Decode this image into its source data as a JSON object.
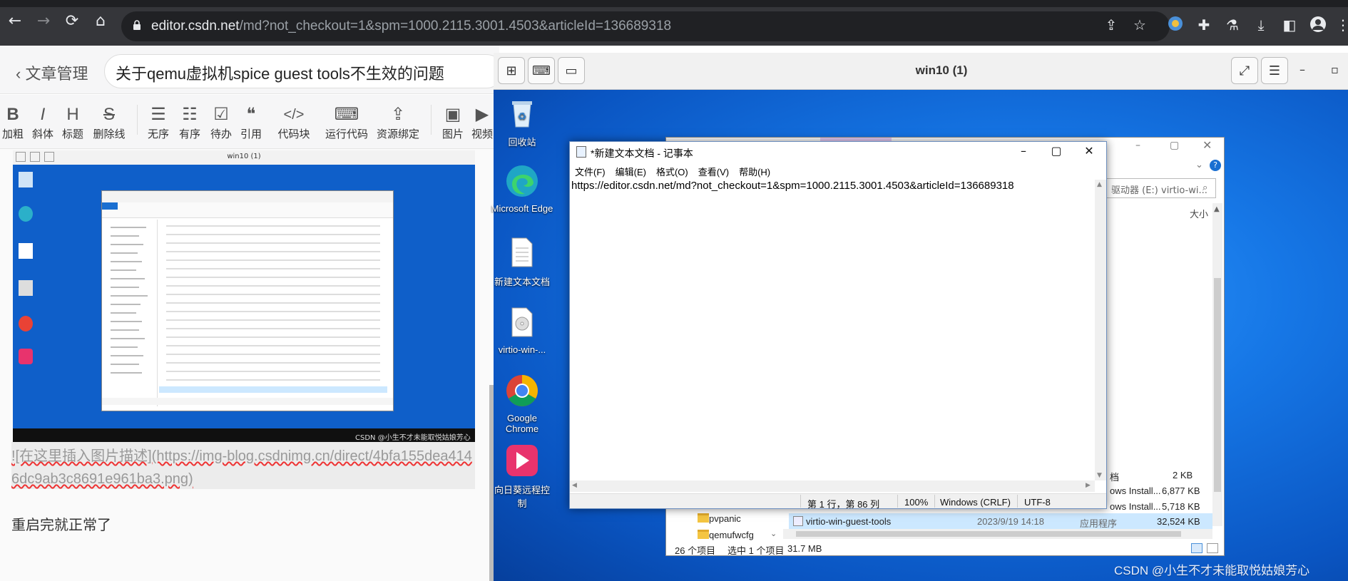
{
  "browser": {
    "url_host": "editor.csdn.net",
    "url_rest": "/md?not_checkout=1&spm=1000.2115.3001.4503&articleId=136689318",
    "icons": [
      "back-icon",
      "forward-icon",
      "reload-icon",
      "home-icon",
      "share-icon",
      "star-icon",
      "extension-icon",
      "puzzle-icon",
      "labs-icon",
      "download-icon",
      "sidebar-icon",
      "profile-icon",
      "more-icon"
    ]
  },
  "editor": {
    "back_label": "文章管理",
    "article_title": "关于qemu虚拟机spice guest tools不生效的问题",
    "toolbar": [
      {
        "icon": "B",
        "label": "加粗"
      },
      {
        "icon": "I",
        "label": "斜体"
      },
      {
        "icon": "H",
        "label": "标题"
      },
      {
        "icon": "S",
        "label": "删除线"
      },
      {
        "icon": "☰",
        "label": "无序"
      },
      {
        "icon": "☷",
        "label": "有序"
      },
      {
        "icon": "☑",
        "label": "待办"
      },
      {
        "icon": "❝",
        "label": "引用"
      },
      {
        "icon": "</>",
        "label": "代码块"
      },
      {
        "icon": "⌨",
        "label": "运行代码"
      },
      {
        "icon": "⇪",
        "label": "资源绑定"
      },
      {
        "icon": "▣",
        "label": "图片"
      },
      {
        "icon": "▶",
        "label": "视频"
      }
    ],
    "image_markdown": "![在这里插入图片描述](https://img-blog.csdnimg.cn/direct/4bfa155dea4146dc9ab3c8691e961ba3.png)",
    "paragraph": "重启完就正常了"
  },
  "mini_screenshot": {
    "title": "win10 (1)",
    "watermark": "CSDN @小生不才未能取悦姑娘芳心"
  },
  "vm": {
    "title": "win10 (1)",
    "left_buttons": [
      "grid-icon",
      "keyboard-icon",
      "display-icon"
    ],
    "right_buttons": [
      "fullscreen-icon",
      "menu-icon"
    ],
    "window_controls": [
      "–",
      "▫"
    ],
    "desktop_icons": [
      {
        "label": "回收站",
        "icon": "recycle-bin-icon"
      },
      {
        "label": "Microsoft Edge",
        "icon": "edge-icon"
      },
      {
        "label": "新建文本文档",
        "icon": "text-file-icon"
      },
      {
        "label": "virtio-win-...",
        "icon": "disc-icon"
      },
      {
        "label": "Google Chrome",
        "icon": "chrome-icon"
      },
      {
        "label": "向日葵远程控制",
        "icon": "sunlogin-icon"
      }
    ]
  },
  "explorer": {
    "search_placeholder": "驱动器 (E:) virtio-wi...",
    "size_header": "大小",
    "rows_right": [
      {
        "name_tail": "档",
        "size": "2 KB"
      },
      {
        "name_tail": "ows Install...",
        "size": "6,877 KB"
      },
      {
        "name_tail": "ows Install...",
        "size": "5,718 KB"
      }
    ],
    "selected_file": {
      "name": "virtio-win-guest-tools",
      "date": "2023/9/19 14:18",
      "type": "应用程序",
      "size": "32,524 KB"
    },
    "sidebar_items": [
      "pvpanic",
      "qemufwcfg"
    ],
    "status_count": "26 个项目",
    "status_selected": "选中 1 个项目",
    "status_size": "31.7 MB"
  },
  "notepad": {
    "title": "*新建文本文档 - 记事本",
    "menu": [
      "文件(F)",
      "编辑(E)",
      "格式(O)",
      "查看(V)",
      "帮助(H)"
    ],
    "content": "https://editor.csdn.net/md?not_checkout=1&spm=1000.2115.3001.4503&articleId=136689318",
    "status": {
      "position": "第 1 行，第 86 列",
      "zoom": "100%",
      "line_ending": "Windows (CRLF)",
      "encoding": "UTF-8"
    }
  },
  "watermark": "CSDN @小生不才未能取悦姑娘芳心"
}
